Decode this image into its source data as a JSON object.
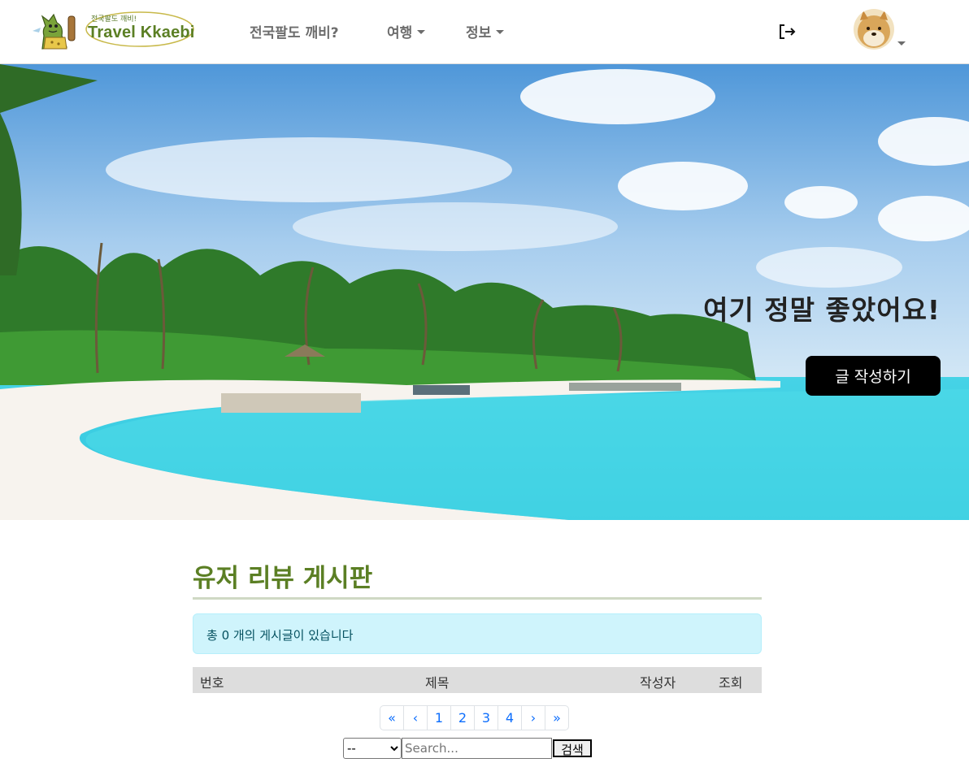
{
  "brand": {
    "tagline": "전국팔도 깨비!",
    "name": "Travel Kkaebi"
  },
  "nav": {
    "about": "전국팔도 깨비?",
    "travel": "여행",
    "info": "정보"
  },
  "icons": {
    "logout": "logout-icon",
    "avatar": "user-avatar",
    "dropdown": "caret-down-icon"
  },
  "hero": {
    "title": "여기 정말 좋았어요!",
    "write_button": "글 작성하기"
  },
  "board": {
    "title": "유저 리뷰 게시판",
    "alert": "총 0 개의 게시글이 있습니다",
    "columns": [
      "번호",
      "제목",
      "작성자",
      "조회"
    ],
    "rows": []
  },
  "pagination": {
    "items": [
      "«",
      "‹",
      "1",
      "2",
      "3",
      "4",
      "›",
      "»"
    ]
  },
  "search": {
    "select_value": "--",
    "placeholder": "Search...",
    "button": "검색"
  },
  "colors": {
    "brand_green": "#5b7f24",
    "alert_bg": "#cff4fc",
    "link_blue": "#0d6efd",
    "table_header_bg": "#dddddd"
  }
}
